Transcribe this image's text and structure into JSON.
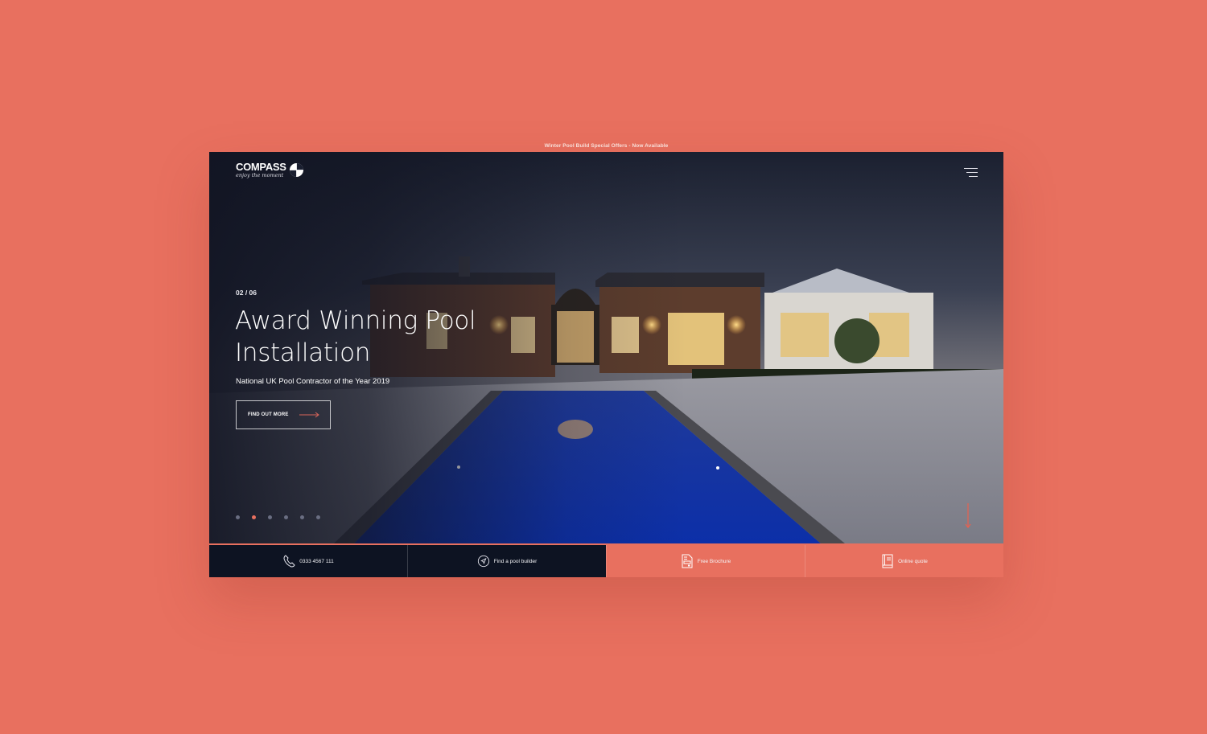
{
  "announcement": "Winter Pool Build Special Offers - Now Available",
  "colors": {
    "background": "#e8705f",
    "accent": "#e8705f",
    "dark": "#0d1322"
  },
  "header": {
    "logo_name": "COMPASS",
    "logo_tagline": "enjoy the moment",
    "logo_icon": "compass-quadrant-icon",
    "menu_icon": "hamburger-menu-icon"
  },
  "hero": {
    "counter": "02 / 06",
    "title": "Award Winning Pool Installation",
    "subtitle": "National UK Pool Contractor of the Year 2019",
    "cta_label": "FIND OUT MORE",
    "cta_icon": "arrow-right-icon",
    "slides_total": 6,
    "active_slide": 2,
    "scroll_icon": "arrow-down-icon",
    "image_description": "Lit brick house with illuminated pool at dusk"
  },
  "bottom_bar": [
    {
      "label": "0333 4567 111",
      "icon": "phone-icon",
      "style": "dark"
    },
    {
      "label": "Find a pool builder",
      "icon": "navigation-icon",
      "style": "dark"
    },
    {
      "label": "Free Brochure",
      "icon": "brochure-icon",
      "style": "accent"
    },
    {
      "label": "Online quote",
      "icon": "book-icon",
      "style": "accent"
    }
  ]
}
